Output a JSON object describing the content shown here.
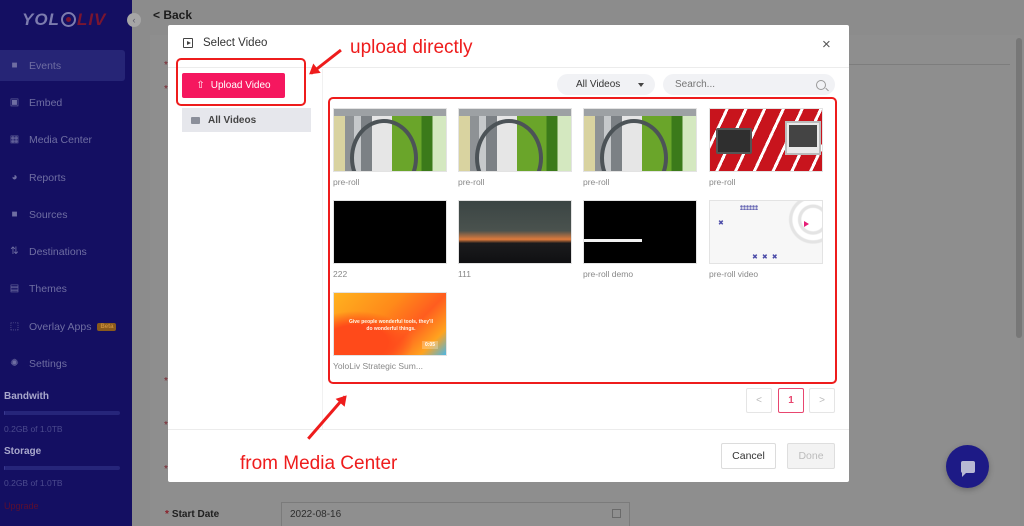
{
  "sidebar": {
    "logo_left": "YOL",
    "logo_right": "LIV",
    "items": [
      {
        "label": "Events",
        "icon": "video-camera-icon",
        "active": true
      },
      {
        "label": "Embed",
        "icon": "code-icon"
      },
      {
        "label": "Media Center",
        "icon": "clapperboard-icon"
      },
      {
        "label": "Reports",
        "icon": "pie-chart-icon"
      },
      {
        "label": "Sources",
        "icon": "camera-icon"
      },
      {
        "label": "Destinations",
        "icon": "transfer-icon"
      },
      {
        "label": "Themes",
        "icon": "layout-icon"
      },
      {
        "label": "Overlay Apps",
        "icon": "overlay-icon",
        "badge": "Beta"
      },
      {
        "label": "Settings",
        "icon": "gear-icon"
      }
    ],
    "bandwidth": {
      "label": "Bandwith",
      "usage": "0.2GB of 1.0TB",
      "fraction": 0.0002
    },
    "storage": {
      "label": "Storage",
      "usage": "0.2GB of 1.0TB",
      "fraction": 0.0002
    },
    "upgrade": "Upgrade",
    "collapse_icon": "‹"
  },
  "page": {
    "back_label": "< Back",
    "start_date_label": "Start Date",
    "start_date_value": "2022-08-16",
    "required_mark": "*"
  },
  "modal": {
    "title": "Select Video",
    "close_icon": "×",
    "upload_button": "Upload Video",
    "upload_icon": "⇧",
    "folders": [
      {
        "label": "All Videos"
      }
    ],
    "filter": {
      "selected": "All Videos"
    },
    "search": {
      "placeholder": "Search...",
      "value": ""
    },
    "videos": [
      {
        "name": "pre-roll",
        "thumb": "t-pipe"
      },
      {
        "name": "pre-roll",
        "thumb": "t-pipe"
      },
      {
        "name": "pre-roll",
        "thumb": "t-pipe"
      },
      {
        "name": "pre-roll",
        "thumb": "t-red"
      },
      {
        "name": "222",
        "thumb": "t-black"
      },
      {
        "name": "111",
        "thumb": "t-sunset"
      },
      {
        "name": "pre-roll demo",
        "thumb": "t-demo"
      },
      {
        "name": "pre-roll video",
        "thumb": "t-white"
      },
      {
        "name": "YoloLiv Strategic Sum...",
        "thumb": "t-orange",
        "overlay_text": "Give people wonderful tools, they'll do wonderful things.",
        "duration": "0:05"
      }
    ],
    "pagination": {
      "prev": "<",
      "current": "1",
      "next": ">"
    },
    "cancel_label": "Cancel",
    "done_label": "Done"
  },
  "annotations": {
    "upload": "upload directly",
    "media_center": "from Media Center",
    "color": "#ee1c1c"
  },
  "chat": {
    "icon": "chat-bubble-icon"
  }
}
